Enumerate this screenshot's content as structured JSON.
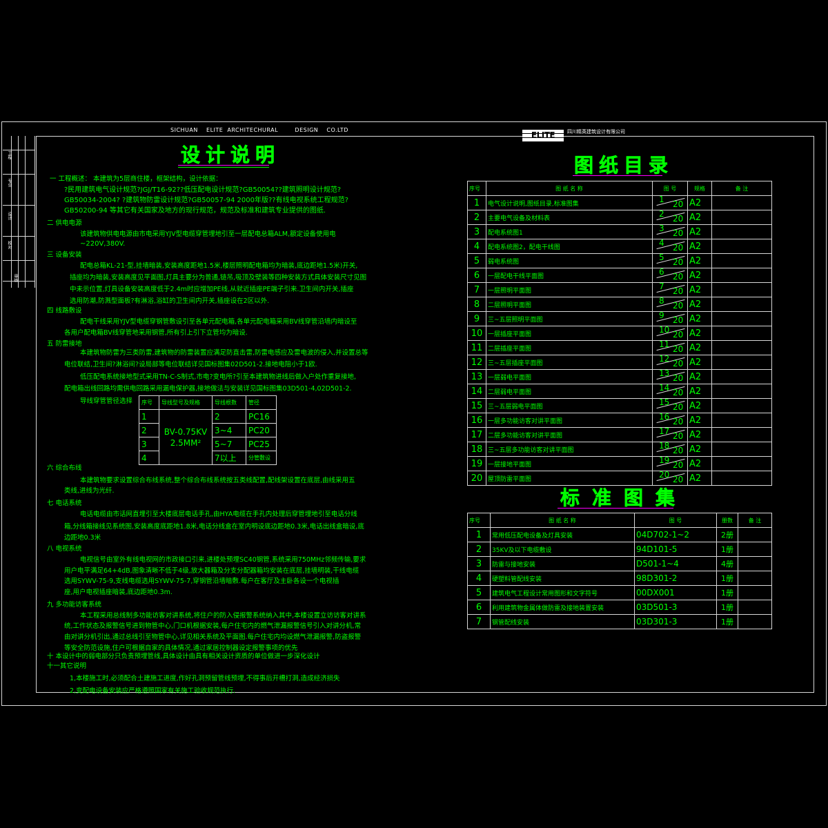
{
  "header": {
    "english": "SICHUAN    ELITE  ARCHITECHURAL        DESIGN    CO.LTD",
    "logo": "ELITE",
    "chinese": "四川精英建筑设计有限公司"
  },
  "side_labels": [
    "工程",
    "专业",
    "设计",
    "校对",
    "审核"
  ],
  "design_notes": {
    "title": "设计说明",
    "lines": [
      "一  工程概述：  本建筑为5层商住楼，框架结构，设计依据：",
      "?民用建筑电气设计规范?JGJ/T16-92??低压配电设计规范?GB50054??建筑照明设计规范?",
      "GB50034-2004? ?建筑物防雷设计规范?GB50057-94  2000年版??有线电视系统工程规范?",
      "GB50200-94  等其它有关国家及地方的现行规范，规范及标准和建筑专业提供的图纸.",
      "二  供电电源",
      "该建筑物供电电源由市电采用YJV型电缆穿管埋地引至一层配电总箱ALM,额定设备使用电",
      "~220V,380V.",
      "三  设备安装",
      "配电总箱KL-21-型,挂墙暗装,安装高度距地1.5米,楼层照明配电箱均为暗装,底边距地1.5米)开关,",
      "插座均为暗装,安装高度见平面图,灯具主要分为普通,链吊,吸顶及壁装等四种安装方式具体安装尺寸见图",
      "中未示位置,灯具设备安装高度低于2.4m时应增加PE线,从就近插座PE端子引来.卫生间内开关,插座",
      "选用防潮,防溅型面板?有淋浴,浴缸的卫生间内开关,插座设在2区以外.",
      "四  线路敷设",
      "配电干线采用YJV型电缆穿钢管敷设引至各单元配电箱,各单元配电箱采用BV线穿管沿墙内暗设至",
      "各用户配电箱BV线穿管地采用钢管,所有引上引下立管均为暗设.",
      "五  防雷接地",
      "本建筑物防雷为三类防雷,建筑物的防雷装置应满足防直击雷,防雷电感应及雷电波的侵入,并设置总等",
      "电位联结,卫生间?淋浴间?设局部等电位联结详见国标图集02D501-2.接地电阻小于1欧.",
      "低压配电系统接地型式采用TN-C-S制式,市电?变电所?引至本建筑物进线后做入户处作重复接地,",
      "配电箱出线回路均需供电回路采用漏电保护器,接地做法与安装详见国标图集03D501-4,02D501-2.",
      "导线穿管管径选择"
    ],
    "lines2": [
      "六  综合布线",
      "本建筑物要求设置综合布线系统,整个综合布线系统按五类线配置,配线架设置在底层,由线采用五",
      "类线,进线为光纤.",
      "七  电话系统",
      "电话电缆由市话网直埋引至大楼底层电话手孔,由HYA电缆在手孔内处理后穿管埋地引至电话分线",
      "箱,分线箱接线见系统图,安装高度底距地1.8米,电话分线盒在室内明设底边距地0.3米,电话出线盒暗设,底",
      "边距地0.3米",
      "八  电视系统",
      "电视信号由室外有线电视网的市政接口引来,进楼处预埋SC40钢管,系统采用750MHz邻频传输,要求",
      "用户电平满足64+4dB,图象清晰不低于4级,放大器箱及分支分配器箱均安装在底层,挂墙明装,干线电缆",
      "选用SYWV-75-9,支线电缆选用SYWV-75-7,穿钢管沿墙暗敷.每户在客厅及主卧各设一个电视插",
      "座,用户电视插座暗装,底边距地0.3m.",
      "九  多功能访客系统",
      "本工程采用总线制多功能访客对讲系统,将住户的防入侵报警系统纳入其中,本楼设置立访访客对讲系",
      "统,工作状态及报警信号进到物管中心,门口机根据安装,每户住宅内的燃气泄漏报警信号引入对讲分机,常",
      "由对讲分机引出,通过总线引至物管中心,详见相关系统及平面图.每户住宅内均设燃气泄漏报警,防盗报警",
      "等安全防范设施,住户可根据自家的具体情况,通过家居控制器设定报警事项的优先",
      "十  本设计中的弱电部分只负责预埋管线,具体设计由具有相关设计资质的单位做进一步深化设计",
      "十一其它说明",
      "1,本楼施工时,必须配合土建施工进度,作好孔洞预留管线预埋,不得事后开槽打洞,造成经济损失",
      "2,变配电设备安装应严格遵照国家有关施工验收规范执行."
    ],
    "conduit_table": {
      "headers": [
        "序号",
        "导线型号及规格",
        "导线根数",
        "管径"
      ],
      "wire_spec": [
        "BV-0.75KV",
        "2.5MM²"
      ],
      "rows": [
        {
          "no": "1",
          "count": "2",
          "pipe": "PC16"
        },
        {
          "no": "2",
          "count": "3~4",
          "pipe": "PC20"
        },
        {
          "no": "3",
          "count": "5~7",
          "pipe": "PC25"
        },
        {
          "no": "4",
          "count": "7以上",
          "pipe": "分管敷设"
        }
      ]
    }
  },
  "drawing_list": {
    "title": "图纸目录",
    "headers": [
      "序号",
      "图    纸    名    称",
      "图  号",
      "规格",
      "备  注"
    ],
    "rows": [
      {
        "no": "1",
        "name": "电气设计说明,图纸目录,标准图集",
        "a": "1",
        "b": "20",
        "fmt": "A2"
      },
      {
        "no": "2",
        "name": "主要电气设备及材料表",
        "a": "2",
        "b": "20",
        "fmt": "A2"
      },
      {
        "no": "3",
        "name": "配电系统图1",
        "a": "3",
        "b": "20",
        "fmt": "A2"
      },
      {
        "no": "4",
        "name": "配电系统图2，配电干线图",
        "a": "4",
        "b": "20",
        "fmt": "A2"
      },
      {
        "no": "5",
        "name": "弱电系统图",
        "a": "5",
        "b": "20",
        "fmt": "A2"
      },
      {
        "no": "6",
        "name": "一层配电干线平面图",
        "a": "6",
        "b": "20",
        "fmt": "A2"
      },
      {
        "no": "7",
        "name": "一层照明平面图",
        "a": "7",
        "b": "20",
        "fmt": "A2"
      },
      {
        "no": "8",
        "name": "二层照明平面图",
        "a": "8",
        "b": "20",
        "fmt": "A2"
      },
      {
        "no": "9",
        "name": "三~五层照明平面图",
        "a": "9",
        "b": "20",
        "fmt": "A2"
      },
      {
        "no": "10",
        "name": "一层插座平面图",
        "a": "10",
        "b": "20",
        "fmt": "A2"
      },
      {
        "no": "11",
        "name": "二层插座平面图",
        "a": "11",
        "b": "20",
        "fmt": "A2"
      },
      {
        "no": "12",
        "name": "三~五层插座平面图",
        "a": "12",
        "b": "20",
        "fmt": "A2"
      },
      {
        "no": "13",
        "name": "一层弱电平面图",
        "a": "13",
        "b": "20",
        "fmt": "A2"
      },
      {
        "no": "14",
        "name": "二层弱电平面图",
        "a": "14",
        "b": "20",
        "fmt": "A2"
      },
      {
        "no": "15",
        "name": "三~五层弱电平面图",
        "a": "15",
        "b": "20",
        "fmt": "A2"
      },
      {
        "no": "16",
        "name": "一层多功能访客对讲平面图",
        "a": "16",
        "b": "20",
        "fmt": "A2"
      },
      {
        "no": "17",
        "name": "二层多功能访客对讲平面图",
        "a": "17",
        "b": "20",
        "fmt": "A2"
      },
      {
        "no": "18",
        "name": "三~五层多功能访客对讲平面图",
        "a": "18",
        "b": "20",
        "fmt": "A2"
      },
      {
        "no": "19",
        "name": "一层接地平面图",
        "a": "19",
        "b": "20",
        "fmt": "A2"
      },
      {
        "no": "20",
        "name": "屋顶防雷平面图",
        "a": "20",
        "b": "20",
        "fmt": "A2"
      }
    ]
  },
  "standard_atlas": {
    "title": "标准图集",
    "headers": [
      "序号",
      "图    纸    名    称",
      "图        号",
      "册数",
      "备  注"
    ],
    "rows": [
      {
        "no": "1",
        "name": "常用低压配电设备及灯具安装",
        "code": "04D702-1~2",
        "vol": "2册"
      },
      {
        "no": "2",
        "name": "35KV及以下电缆敷设",
        "code": "94D101-5",
        "vol": "1册"
      },
      {
        "no": "3",
        "name": "防雷与接地安装",
        "code": "D501-1~4",
        "vol": "4册"
      },
      {
        "no": "4",
        "name": "硬塑料管配线安装",
        "code": "98D301-2",
        "vol": "1册"
      },
      {
        "no": "5",
        "name": "建筑电气工程设计常用图形和文字符号",
        "code": "00DX001",
        "vol": "1册"
      },
      {
        "no": "6",
        "name": "利用建筑物金属体做防雷及接地装置安装",
        "code": "03D501-3",
        "vol": "1册"
      },
      {
        "no": "7",
        "name": "钢管配线安装",
        "code": "03D301-3",
        "vol": "1册"
      }
    ]
  }
}
